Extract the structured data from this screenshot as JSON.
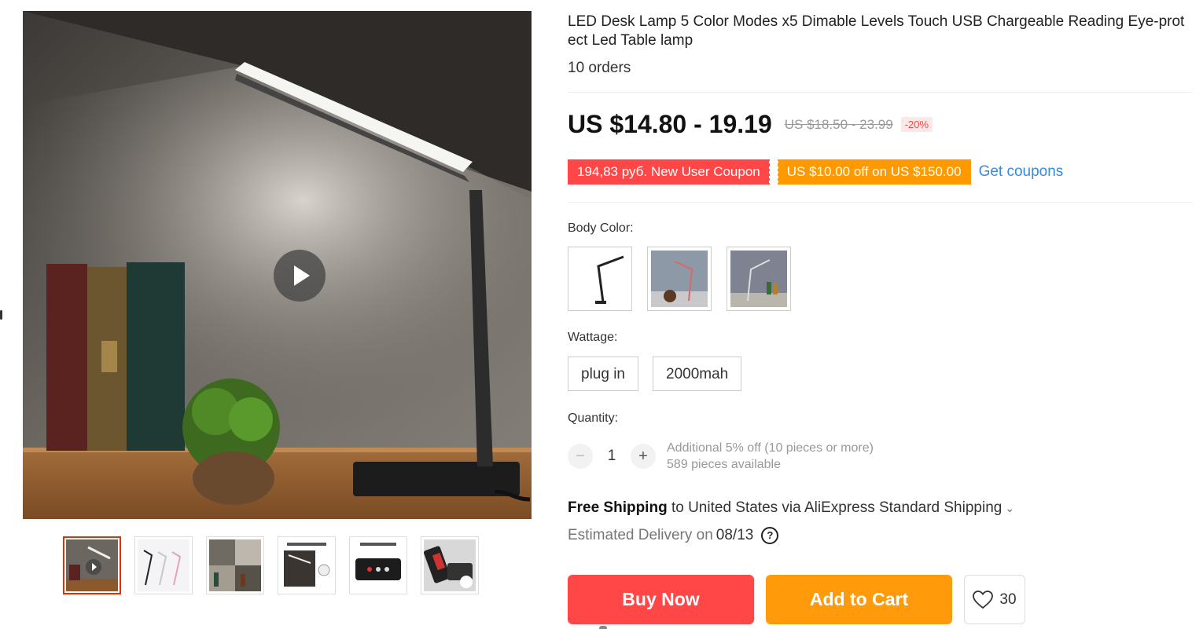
{
  "product": {
    "title": "LED Desk Lamp 5 Color Modes x5 Dimable Levels Touch USB Chargeable Reading Eye-protect Led Table lamp",
    "orders": "10 orders"
  },
  "price": {
    "current": "US $14.80 - 19.19",
    "original": "US $18.50 - 23.99",
    "discount": "-20%"
  },
  "coupons": {
    "new_user": "194,83 руб. New User Coupon",
    "store": "US $10.00 off on US $150.00",
    "get_coupons": "Get coupons"
  },
  "body_color": {
    "label": "Body Color:",
    "options": [
      "black lamp",
      "pink lamp",
      "silver lamp"
    ]
  },
  "wattage": {
    "label": "Wattage:",
    "options": [
      "plug in",
      "2000mah"
    ]
  },
  "quantity": {
    "label": "Quantity:",
    "value": "1",
    "minus": "−",
    "plus": "+",
    "note_discount": "Additional 5% off (10 pieces or more)",
    "note_available": "589 pieces available"
  },
  "shipping": {
    "free": "Free Shipping",
    "rest": " to United States via AliExpress Standard Shipping",
    "chevron": "⌄",
    "estimated_label": "Estimated Delivery on",
    "estimated_date": "08/13",
    "help": "?"
  },
  "actions": {
    "buy_now": "Buy Now",
    "add_to_cart": "Add to Cart",
    "wishlist_count": "30"
  },
  "colors": {
    "red": "#ff4747",
    "orange": "#ff9900",
    "link": "#3a8bd8"
  },
  "icons": [
    "play-icon",
    "heart-icon",
    "help-circle-icon",
    "chevron-down-icon"
  ]
}
